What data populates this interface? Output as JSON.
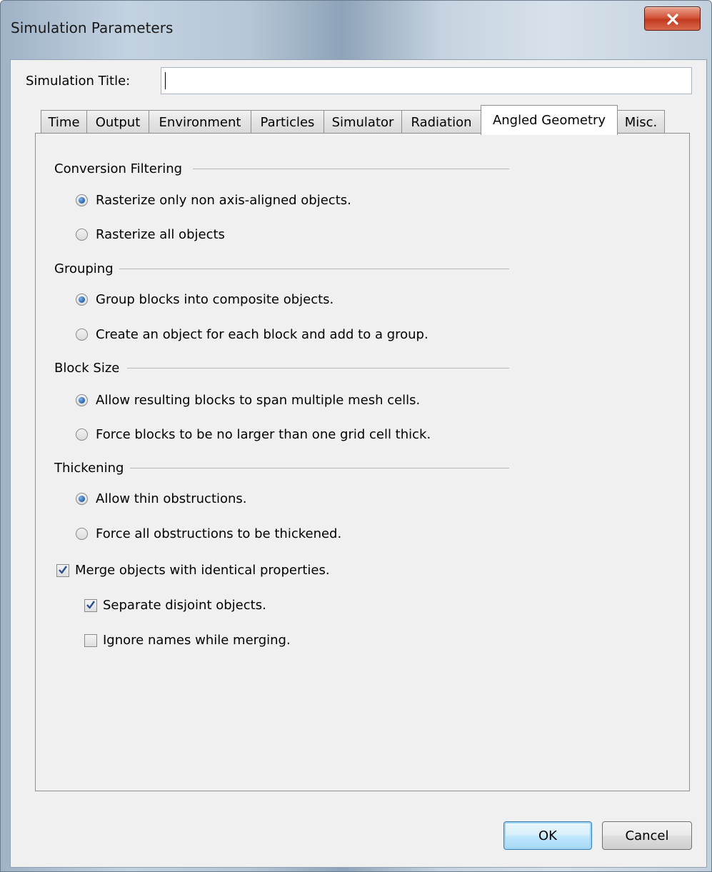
{
  "window": {
    "title": "Simulation Parameters"
  },
  "simulation_title": {
    "label": "Simulation Title:",
    "value": ""
  },
  "tabs": [
    {
      "label": "Time"
    },
    {
      "label": "Output"
    },
    {
      "label": "Environment"
    },
    {
      "label": "Particles"
    },
    {
      "label": "Simulator"
    },
    {
      "label": "Radiation"
    },
    {
      "label": "Angled Geometry",
      "active": true
    },
    {
      "label": "Misc."
    }
  ],
  "groups": {
    "conversion_filtering": {
      "label": "Conversion Filtering",
      "options": [
        {
          "label": "Rasterize only non axis-aligned objects.",
          "checked": true
        },
        {
          "label": "Rasterize all objects",
          "checked": false
        }
      ]
    },
    "grouping": {
      "label": "Grouping",
      "options": [
        {
          "label": "Group blocks into composite objects.",
          "checked": true
        },
        {
          "label": "Create an object for each block and add to a group.",
          "checked": false
        }
      ]
    },
    "block_size": {
      "label": "Block Size",
      "options": [
        {
          "label": "Allow resulting blocks to span multiple mesh cells.",
          "checked": true
        },
        {
          "label": "Force blocks to be no larger than one grid cell thick.",
          "checked": false
        }
      ]
    },
    "thickening": {
      "label": "Thickening",
      "options": [
        {
          "label": "Allow thin obstructions.",
          "checked": true
        },
        {
          "label": "Force all obstructions to be thickened.",
          "checked": false
        }
      ]
    }
  },
  "checkboxes": {
    "merge": {
      "label": "Merge objects with identical properties.",
      "checked": true
    },
    "separate_disjoint": {
      "label": "Separate disjoint objects.",
      "checked": true
    },
    "ignore_names": {
      "label": "Ignore names while merging.",
      "checked": false
    }
  },
  "buttons": {
    "ok": "OK",
    "cancel": "Cancel"
  },
  "icons": {
    "close": "close-icon",
    "check": "checkmark-icon"
  },
  "colors": {
    "close_button": "#c23a1f",
    "radio_dot": "#2d6bb3",
    "check_mark": "#2a4f8f",
    "default_button_border": "#3c7fb1"
  }
}
